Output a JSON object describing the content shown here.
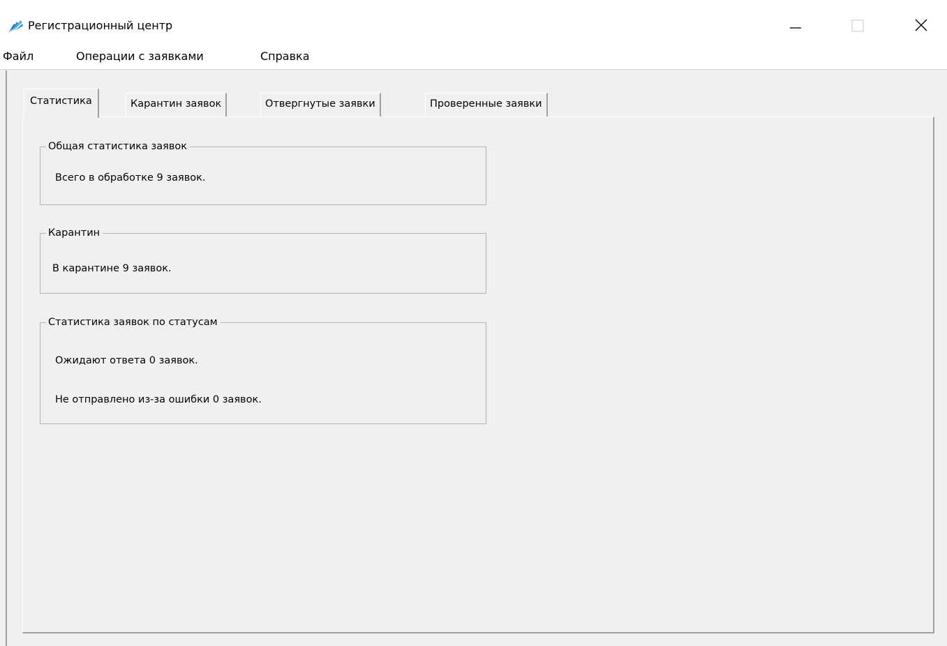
{
  "window": {
    "title": "Регистрационный центр",
    "minimize_label": "–",
    "close_label": "✕"
  },
  "menu": {
    "items": [
      "Файл",
      "Операции с заявками",
      "Справка"
    ]
  },
  "tabs": [
    {
      "label": "Статистика",
      "active": true
    },
    {
      "label": "Карантин заявок",
      "active": false
    },
    {
      "label": "Отвергнутые заявки",
      "active": false
    },
    {
      "label": "Проверенные заявки",
      "active": false
    }
  ],
  "groups": {
    "general": {
      "title": "Общая статистика заявок",
      "lines": [
        "Всего в обработке 9 заявок."
      ]
    },
    "quarantine": {
      "title": "Карантин",
      "lines": [
        "В карантине 9 заявок."
      ]
    },
    "by_status": {
      "title": "Статистика заявок по статусам",
      "lines": [
        "Ожидают ответа 0 заявок.",
        "Не отправлено из-за ошибки 0 заявок."
      ]
    }
  },
  "icons": {
    "app": "wing-app-icon",
    "minimize": "minimize-icon",
    "maximize": "maximize-icon",
    "close": "close-icon"
  }
}
